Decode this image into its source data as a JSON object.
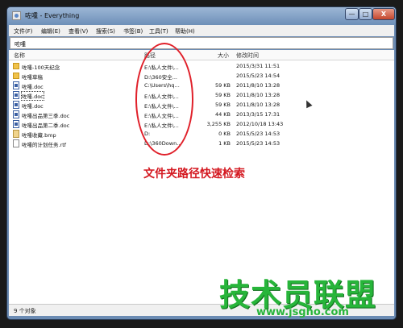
{
  "window": {
    "title": "咗喠 - Everything"
  },
  "titlebar_buttons": {
    "minimize": "—",
    "maximize": "□",
    "close": "X"
  },
  "menu": [
    "文件(F)",
    "编辑(E)",
    "查看(V)",
    "搜索(S)",
    "书签(B)",
    "工具(T)",
    "帮助(H)"
  ],
  "search": {
    "value": "咗喠"
  },
  "columns": {
    "name": "名称",
    "path": "路径",
    "size": "大小",
    "modified": "修改时间"
  },
  "rows": [
    {
      "name": "咗喠-100天纪念",
      "icon": "folder-icon",
      "path": "E:\\私人文件\\...",
      "size": "",
      "modified": "2015/3/31 11:51"
    },
    {
      "name": "咗喠草稿",
      "icon": "folder-icon",
      "path": "D:\\360安全...",
      "size": "",
      "modified": "2015/5/23 14:54"
    },
    {
      "name": "咗喠.doc",
      "icon": "doc-icon",
      "path": "C:\\Users\\hq...",
      "size": "59 KB",
      "modified": "2011/8/10 13:28"
    },
    {
      "name": "咗喠.doc",
      "icon": "doc-icon",
      "path": "E:\\私人文件\\...",
      "size": "59 KB",
      "modified": "2011/8/10 13:28"
    },
    {
      "name": "咗喠.doc",
      "icon": "doc-icon",
      "path": "E:\\私人文件\\...",
      "size": "59 KB",
      "modified": "2011/8/10 13:28"
    },
    {
      "name": "咗喠出品第三季.doc",
      "icon": "doc-icon",
      "path": "E:\\私人文件\\...",
      "size": "44 KB",
      "modified": "2013/3/15 17:31"
    },
    {
      "name": "咗喠出品第二季.doc",
      "icon": "doc-icon",
      "path": "E:\\私人文件\\...",
      "size": "3,255 KB",
      "modified": "2012/10/18 13:43"
    },
    {
      "name": "咗喠收藏.bmp",
      "icon": "bmp-icon",
      "path": "D:",
      "size": "0 KB",
      "modified": "2015/5/23 14:53"
    },
    {
      "name": "咗喠的计划任务.rtf",
      "icon": "rtf-icon",
      "path": "D:\\360Down...",
      "size": "1 KB",
      "modified": "2015/5/23 14:53"
    }
  ],
  "annotation": "文件夹路径快速检索",
  "status": "9 个对象",
  "watermark": {
    "brand": "技术员联盟",
    "url": "www.jsgho.com"
  },
  "colors": {
    "annotation": "#e0202a",
    "watermark": "#27b53a",
    "titlebar": "#7d9cc4"
  }
}
